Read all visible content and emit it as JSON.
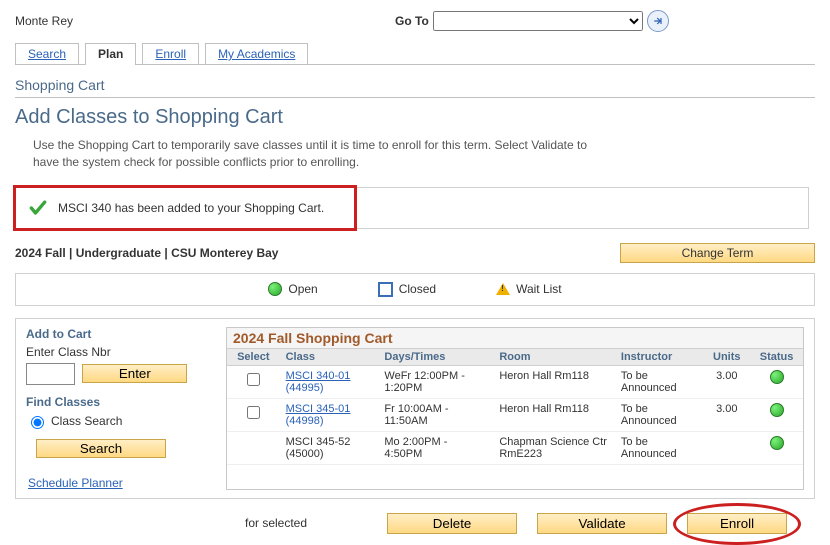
{
  "header": {
    "user_name": "Monte Rey",
    "goto_label": "Go To"
  },
  "tabs": [
    {
      "label": "Search"
    },
    {
      "label": "Plan"
    },
    {
      "label": "Enroll"
    },
    {
      "label": "My Academics"
    }
  ],
  "section_title": "Shopping Cart",
  "page_title": "Add Classes to Shopping Cart",
  "instructions": "Use the Shopping Cart to temporarily save classes until it is time to enroll for this term.  Select Validate to have the system check for possible conflicts prior to enrolling.",
  "message": "MSCI  340 has been added to your Shopping Cart.",
  "term_text": "2024 Fall | Undergraduate | CSU Monterey Bay",
  "change_term": "Change Term",
  "legend": {
    "open": "Open",
    "closed": "Closed",
    "wait": "Wait List"
  },
  "sidebar": {
    "add_to_cart": "Add to Cart",
    "enter_class_nbr": "Enter Class Nbr",
    "enter": "Enter",
    "find_classes": "Find Classes",
    "class_search": "Class Search",
    "search": "Search",
    "schedule_planner": "Schedule Planner"
  },
  "cart": {
    "title": "2024 Fall Shopping Cart",
    "cols": {
      "select": "Select",
      "class": "Class",
      "days": "Days/Times",
      "room": "Room",
      "instructor": "Instructor",
      "units": "Units",
      "status": "Status"
    },
    "rows": [
      {
        "has_checkbox": true,
        "class_name": "MSCI 340-01",
        "class_nbr": "(44995)",
        "days": "WeFr 12:00PM - 1:20PM",
        "room": "Heron Hall Rm118",
        "instructor": "To be Announced",
        "units": "3.00",
        "status": "open"
      },
      {
        "has_checkbox": true,
        "class_name": "MSCI 345-01",
        "class_nbr": "(44998)",
        "days": "Fr 10:00AM - 11:50AM",
        "room": "Heron Hall Rm118",
        "instructor": "To be Announced",
        "units": "3.00",
        "status": "open"
      },
      {
        "has_checkbox": false,
        "class_name": "MSCI 345-52",
        "class_nbr": "(45000)",
        "days": "Mo 2:00PM - 4:50PM",
        "room": "Chapman Science Ctr RmE223",
        "instructor": "To be Announced",
        "units": "",
        "status": "open"
      }
    ]
  },
  "actions": {
    "for_selected": "for selected",
    "delete": "Delete",
    "validate": "Validate",
    "enroll": "Enroll"
  }
}
